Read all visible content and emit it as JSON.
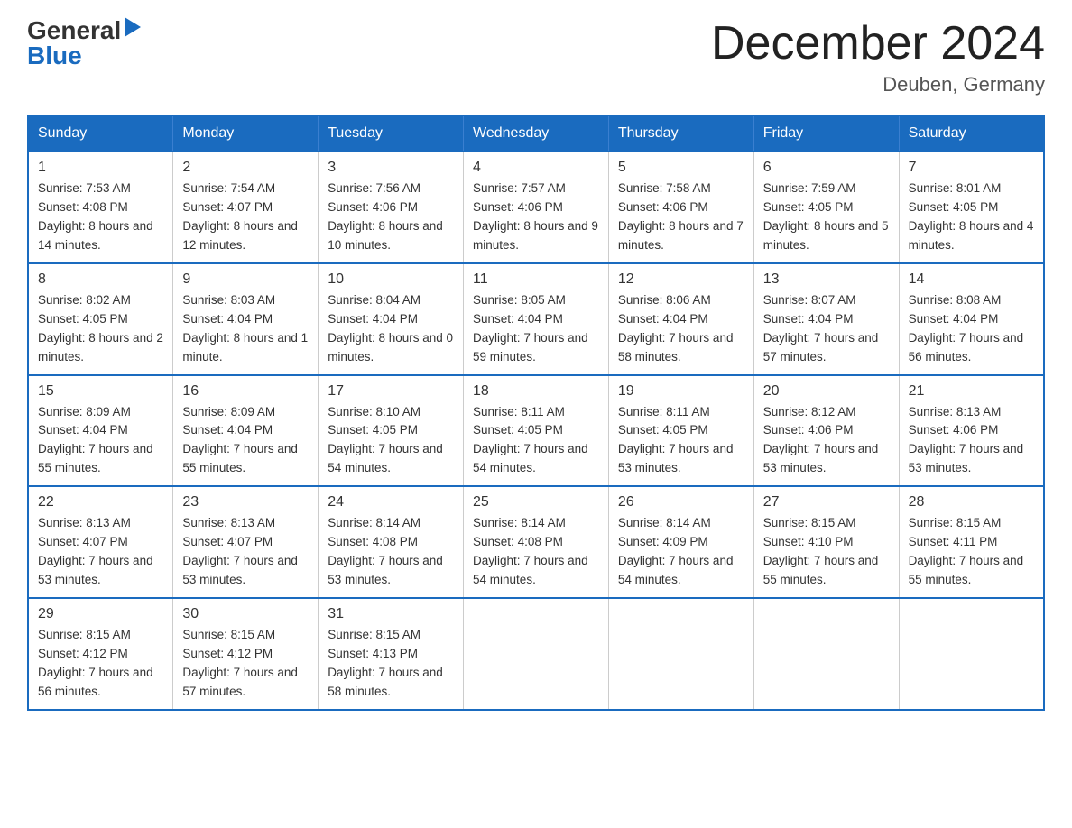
{
  "logo": {
    "general": "General",
    "blue": "Blue"
  },
  "header": {
    "title": "December 2024",
    "location": "Deuben, Germany"
  },
  "days_of_week": [
    "Sunday",
    "Monday",
    "Tuesday",
    "Wednesday",
    "Thursday",
    "Friday",
    "Saturday"
  ],
  "weeks": [
    [
      {
        "day": "1",
        "sunrise": "7:53 AM",
        "sunset": "4:08 PM",
        "daylight": "8 hours and 14 minutes."
      },
      {
        "day": "2",
        "sunrise": "7:54 AM",
        "sunset": "4:07 PM",
        "daylight": "8 hours and 12 minutes."
      },
      {
        "day": "3",
        "sunrise": "7:56 AM",
        "sunset": "4:06 PM",
        "daylight": "8 hours and 10 minutes."
      },
      {
        "day": "4",
        "sunrise": "7:57 AM",
        "sunset": "4:06 PM",
        "daylight": "8 hours and 9 minutes."
      },
      {
        "day": "5",
        "sunrise": "7:58 AM",
        "sunset": "4:06 PM",
        "daylight": "8 hours and 7 minutes."
      },
      {
        "day": "6",
        "sunrise": "7:59 AM",
        "sunset": "4:05 PM",
        "daylight": "8 hours and 5 minutes."
      },
      {
        "day": "7",
        "sunrise": "8:01 AM",
        "sunset": "4:05 PM",
        "daylight": "8 hours and 4 minutes."
      }
    ],
    [
      {
        "day": "8",
        "sunrise": "8:02 AM",
        "sunset": "4:05 PM",
        "daylight": "8 hours and 2 minutes."
      },
      {
        "day": "9",
        "sunrise": "8:03 AM",
        "sunset": "4:04 PM",
        "daylight": "8 hours and 1 minute."
      },
      {
        "day": "10",
        "sunrise": "8:04 AM",
        "sunset": "4:04 PM",
        "daylight": "8 hours and 0 minutes."
      },
      {
        "day": "11",
        "sunrise": "8:05 AM",
        "sunset": "4:04 PM",
        "daylight": "7 hours and 59 minutes."
      },
      {
        "day": "12",
        "sunrise": "8:06 AM",
        "sunset": "4:04 PM",
        "daylight": "7 hours and 58 minutes."
      },
      {
        "day": "13",
        "sunrise": "8:07 AM",
        "sunset": "4:04 PM",
        "daylight": "7 hours and 57 minutes."
      },
      {
        "day": "14",
        "sunrise": "8:08 AM",
        "sunset": "4:04 PM",
        "daylight": "7 hours and 56 minutes."
      }
    ],
    [
      {
        "day": "15",
        "sunrise": "8:09 AM",
        "sunset": "4:04 PM",
        "daylight": "7 hours and 55 minutes."
      },
      {
        "day": "16",
        "sunrise": "8:09 AM",
        "sunset": "4:04 PM",
        "daylight": "7 hours and 55 minutes."
      },
      {
        "day": "17",
        "sunrise": "8:10 AM",
        "sunset": "4:05 PM",
        "daylight": "7 hours and 54 minutes."
      },
      {
        "day": "18",
        "sunrise": "8:11 AM",
        "sunset": "4:05 PM",
        "daylight": "7 hours and 54 minutes."
      },
      {
        "day": "19",
        "sunrise": "8:11 AM",
        "sunset": "4:05 PM",
        "daylight": "7 hours and 53 minutes."
      },
      {
        "day": "20",
        "sunrise": "8:12 AM",
        "sunset": "4:06 PM",
        "daylight": "7 hours and 53 minutes."
      },
      {
        "day": "21",
        "sunrise": "8:13 AM",
        "sunset": "4:06 PM",
        "daylight": "7 hours and 53 minutes."
      }
    ],
    [
      {
        "day": "22",
        "sunrise": "8:13 AM",
        "sunset": "4:07 PM",
        "daylight": "7 hours and 53 minutes."
      },
      {
        "day": "23",
        "sunrise": "8:13 AM",
        "sunset": "4:07 PM",
        "daylight": "7 hours and 53 minutes."
      },
      {
        "day": "24",
        "sunrise": "8:14 AM",
        "sunset": "4:08 PM",
        "daylight": "7 hours and 53 minutes."
      },
      {
        "day": "25",
        "sunrise": "8:14 AM",
        "sunset": "4:08 PM",
        "daylight": "7 hours and 54 minutes."
      },
      {
        "day": "26",
        "sunrise": "8:14 AM",
        "sunset": "4:09 PM",
        "daylight": "7 hours and 54 minutes."
      },
      {
        "day": "27",
        "sunrise": "8:15 AM",
        "sunset": "4:10 PM",
        "daylight": "7 hours and 55 minutes."
      },
      {
        "day": "28",
        "sunrise": "8:15 AM",
        "sunset": "4:11 PM",
        "daylight": "7 hours and 55 minutes."
      }
    ],
    [
      {
        "day": "29",
        "sunrise": "8:15 AM",
        "sunset": "4:12 PM",
        "daylight": "7 hours and 56 minutes."
      },
      {
        "day": "30",
        "sunrise": "8:15 AM",
        "sunset": "4:12 PM",
        "daylight": "7 hours and 57 minutes."
      },
      {
        "day": "31",
        "sunrise": "8:15 AM",
        "sunset": "4:13 PM",
        "daylight": "7 hours and 58 minutes."
      },
      null,
      null,
      null,
      null
    ]
  ],
  "labels": {
    "sunrise": "Sunrise:",
    "sunset": "Sunset:",
    "daylight": "Daylight:"
  }
}
